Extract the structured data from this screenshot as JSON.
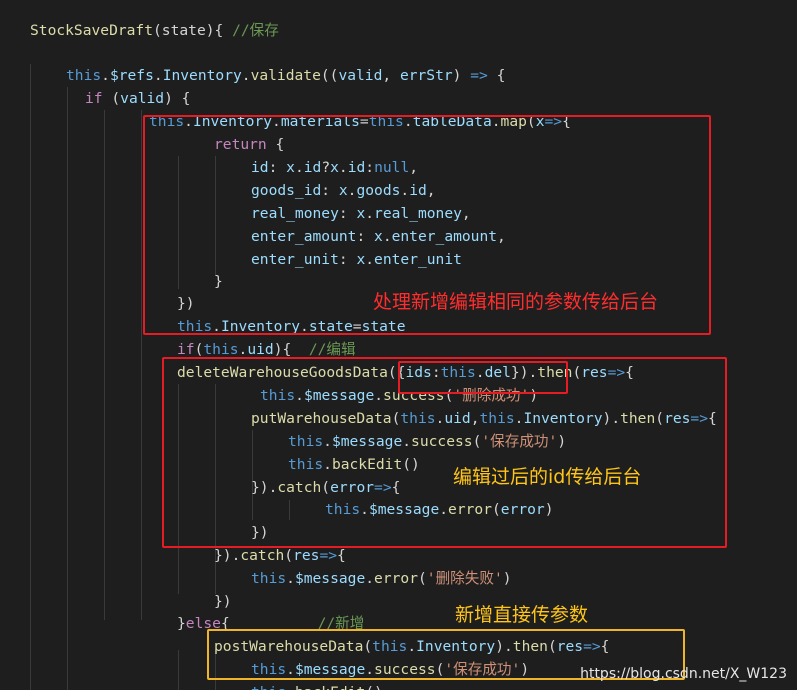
{
  "lines": [
    [
      [
        "tok-func",
        "StockSaveDraft"
      ],
      [
        "tok-plain",
        "(state){ "
      ],
      [
        "tok-cmt",
        "//保存"
      ]
    ],
    [],
    [
      [
        "tok-kw",
        "this"
      ],
      [
        "tok-plain",
        "."
      ],
      [
        "tok-prop",
        "$refs"
      ],
      [
        "tok-plain",
        "."
      ],
      [
        "tok-prop",
        "Inventory"
      ],
      [
        "tok-plain",
        "."
      ],
      [
        "tok-func",
        "validate"
      ],
      [
        "tok-plain",
        "(("
      ],
      [
        "tok-var",
        "valid"
      ],
      [
        "tok-plain",
        ", "
      ],
      [
        "tok-var",
        "errStr"
      ],
      [
        "tok-plain",
        ") "
      ],
      [
        "tok-arrow",
        "=>"
      ],
      [
        "tok-plain",
        " {"
      ]
    ],
    [
      [
        "tok-ctrl",
        "if"
      ],
      [
        "tok-plain",
        " ("
      ],
      [
        "tok-var",
        "valid"
      ],
      [
        "tok-plain",
        ") {"
      ]
    ],
    [
      [
        "tok-kw",
        "this"
      ],
      [
        "tok-plain",
        "."
      ],
      [
        "tok-prop",
        "Inventory"
      ],
      [
        "tok-plain",
        "."
      ],
      [
        "tok-prop",
        "materials"
      ],
      [
        "tok-plain",
        "="
      ],
      [
        "tok-kw",
        "this"
      ],
      [
        "tok-plain",
        "."
      ],
      [
        "tok-prop",
        "tableData"
      ],
      [
        "tok-plain",
        "."
      ],
      [
        "tok-func",
        "map"
      ],
      [
        "tok-plain",
        "("
      ],
      [
        "tok-var",
        "x"
      ],
      [
        "tok-arrow",
        "=>"
      ],
      [
        "tok-plain",
        "{"
      ]
    ],
    [
      [
        "tok-ctrl",
        "return"
      ],
      [
        "tok-plain",
        " {"
      ]
    ],
    [
      [
        "tok-prop",
        "id"
      ],
      [
        "tok-plain",
        ": "
      ],
      [
        "tok-var",
        "x"
      ],
      [
        "tok-plain",
        "."
      ],
      [
        "tok-prop",
        "id"
      ],
      [
        "tok-plain",
        "?"
      ],
      [
        "tok-var",
        "x"
      ],
      [
        "tok-plain",
        "."
      ],
      [
        "tok-prop",
        "id"
      ],
      [
        "tok-plain",
        ":"
      ],
      [
        "tok-kw",
        "null"
      ],
      [
        "tok-plain",
        ","
      ]
    ],
    [
      [
        "tok-prop",
        "goods_id"
      ],
      [
        "tok-plain",
        ": "
      ],
      [
        "tok-var",
        "x"
      ],
      [
        "tok-plain",
        "."
      ],
      [
        "tok-prop",
        "goods"
      ],
      [
        "tok-plain",
        "."
      ],
      [
        "tok-prop",
        "id"
      ],
      [
        "tok-plain",
        ","
      ]
    ],
    [
      [
        "tok-prop",
        "real_money"
      ],
      [
        "tok-plain",
        ": "
      ],
      [
        "tok-var",
        "x"
      ],
      [
        "tok-plain",
        "."
      ],
      [
        "tok-prop",
        "real_money"
      ],
      [
        "tok-plain",
        ","
      ]
    ],
    [
      [
        "tok-prop",
        "enter_amount"
      ],
      [
        "tok-plain",
        ": "
      ],
      [
        "tok-var",
        "x"
      ],
      [
        "tok-plain",
        "."
      ],
      [
        "tok-prop",
        "enter_amount"
      ],
      [
        "tok-plain",
        ","
      ]
    ],
    [
      [
        "tok-prop",
        "enter_unit"
      ],
      [
        "tok-plain",
        ": "
      ],
      [
        "tok-var",
        "x"
      ],
      [
        "tok-plain",
        "."
      ],
      [
        "tok-prop",
        "enter_unit"
      ]
    ],
    [
      [
        "tok-plain",
        "}"
      ]
    ],
    [
      [
        "tok-plain",
        "})"
      ]
    ],
    [
      [
        "tok-kw",
        "this"
      ],
      [
        "tok-plain",
        "."
      ],
      [
        "tok-prop",
        "Inventory"
      ],
      [
        "tok-plain",
        "."
      ],
      [
        "tok-prop",
        "state"
      ],
      [
        "tok-plain",
        "="
      ],
      [
        "tok-var",
        "state"
      ]
    ],
    [
      [
        "tok-ctrl",
        "if"
      ],
      [
        "tok-plain",
        "("
      ],
      [
        "tok-kw",
        "this"
      ],
      [
        "tok-plain",
        "."
      ],
      [
        "tok-prop",
        "uid"
      ],
      [
        "tok-plain",
        "){  "
      ],
      [
        "tok-cmt",
        "//编辑"
      ]
    ],
    [
      [
        "tok-func",
        "deleteWarehouseGoodsData"
      ],
      [
        "tok-plain",
        "({"
      ],
      [
        "tok-prop",
        "ids"
      ],
      [
        "tok-plain",
        ":"
      ],
      [
        "tok-kw",
        "this"
      ],
      [
        "tok-plain",
        "."
      ],
      [
        "tok-prop",
        "del"
      ],
      [
        "tok-plain",
        "})."
      ],
      [
        "tok-func",
        "then"
      ],
      [
        "tok-plain",
        "("
      ],
      [
        "tok-var",
        "res"
      ],
      [
        "tok-arrow",
        "=>"
      ],
      [
        "tok-plain",
        "{"
      ]
    ],
    [
      [
        "tok-kw",
        "this"
      ],
      [
        "tok-plain",
        "."
      ],
      [
        "tok-prop",
        "$message"
      ],
      [
        "tok-plain",
        "."
      ],
      [
        "tok-func",
        "success"
      ],
      [
        "tok-plain",
        "("
      ],
      [
        "tok-str",
        "'删除成功'"
      ],
      [
        "tok-plain",
        ")"
      ]
    ],
    [
      [
        "tok-func",
        "putWarehouseData"
      ],
      [
        "tok-plain",
        "("
      ],
      [
        "tok-kw",
        "this"
      ],
      [
        "tok-plain",
        "."
      ],
      [
        "tok-prop",
        "uid"
      ],
      [
        "tok-plain",
        ","
      ],
      [
        "tok-kw",
        "this"
      ],
      [
        "tok-plain",
        "."
      ],
      [
        "tok-prop",
        "Inventory"
      ],
      [
        "tok-plain",
        ")."
      ],
      [
        "tok-func",
        "then"
      ],
      [
        "tok-plain",
        "("
      ],
      [
        "tok-var",
        "res"
      ],
      [
        "tok-arrow",
        "=>"
      ],
      [
        "tok-plain",
        "{"
      ]
    ],
    [
      [
        "tok-kw",
        "this"
      ],
      [
        "tok-plain",
        "."
      ],
      [
        "tok-prop",
        "$message"
      ],
      [
        "tok-plain",
        "."
      ],
      [
        "tok-func",
        "success"
      ],
      [
        "tok-plain",
        "("
      ],
      [
        "tok-str",
        "'保存成功'"
      ],
      [
        "tok-plain",
        ")"
      ]
    ],
    [
      [
        "tok-kw",
        "this"
      ],
      [
        "tok-plain",
        "."
      ],
      [
        "tok-func",
        "backEdit"
      ],
      [
        "tok-plain",
        "()"
      ]
    ],
    [
      [
        "tok-plain",
        "})."
      ],
      [
        "tok-func",
        "catch"
      ],
      [
        "tok-plain",
        "("
      ],
      [
        "tok-var",
        "error"
      ],
      [
        "tok-arrow",
        "=>"
      ],
      [
        "tok-plain",
        "{"
      ]
    ],
    [
      [
        "tok-kw",
        "this"
      ],
      [
        "tok-plain",
        "."
      ],
      [
        "tok-prop",
        "$message"
      ],
      [
        "tok-plain",
        "."
      ],
      [
        "tok-func",
        "error"
      ],
      [
        "tok-plain",
        "("
      ],
      [
        "tok-var",
        "error"
      ],
      [
        "tok-plain",
        ")"
      ]
    ],
    [
      [
        "tok-plain",
        "})"
      ]
    ],
    [
      [
        "tok-plain",
        "})."
      ],
      [
        "tok-func",
        "catch"
      ],
      [
        "tok-plain",
        "("
      ],
      [
        "tok-var",
        "res"
      ],
      [
        "tok-arrow",
        "=>"
      ],
      [
        "tok-plain",
        "{"
      ]
    ],
    [
      [
        "tok-kw",
        "this"
      ],
      [
        "tok-plain",
        "."
      ],
      [
        "tok-prop",
        "$message"
      ],
      [
        "tok-plain",
        "."
      ],
      [
        "tok-func",
        "error"
      ],
      [
        "tok-plain",
        "("
      ],
      [
        "tok-str",
        "'删除失败'"
      ],
      [
        "tok-plain",
        ")"
      ]
    ],
    [
      [
        "tok-plain",
        "})"
      ]
    ],
    [
      [
        "tok-plain",
        "}"
      ],
      [
        "tok-ctrl",
        "else"
      ],
      [
        "tok-plain",
        "{          "
      ],
      [
        "tok-cmt",
        "//新增"
      ]
    ],
    [
      [
        "tok-func",
        "postWarehouseData"
      ],
      [
        "tok-plain",
        "("
      ],
      [
        "tok-kw",
        "this"
      ],
      [
        "tok-plain",
        "."
      ],
      [
        "tok-prop",
        "Inventory"
      ],
      [
        "tok-plain",
        ")."
      ],
      [
        "tok-func",
        "then"
      ],
      [
        "tok-plain",
        "("
      ],
      [
        "tok-var",
        "res"
      ],
      [
        "tok-arrow",
        "=>"
      ],
      [
        "tok-plain",
        "{"
      ]
    ],
    [
      [
        "tok-kw",
        "this"
      ],
      [
        "tok-plain",
        "."
      ],
      [
        "tok-prop",
        "$message"
      ],
      [
        "tok-plain",
        "."
      ],
      [
        "tok-func",
        "success"
      ],
      [
        "tok-plain",
        "("
      ],
      [
        "tok-str",
        "'保存成功'"
      ],
      [
        "tok-plain",
        ")"
      ]
    ],
    [
      [
        "tok-kw",
        "this"
      ],
      [
        "tok-plain",
        "."
      ],
      [
        "tok-func",
        "backEdit"
      ],
      [
        "tok-plain",
        "()"
      ]
    ]
  ],
  "annotations": {
    "map_note": "处理新增编辑相同的参数传给后台",
    "edit_note": "编辑过后的id传给后台",
    "add_note": "新增直接传参数"
  },
  "watermark": "https://blog.csdn.net/X_W123",
  "colors": {
    "background": "#1e1e1e",
    "keyword": "#569cd6",
    "function": "#dcdcaa",
    "property": "#9cdcfe",
    "string": "#ce9178",
    "comment": "#6a9955",
    "control": "#c586c0",
    "box_red": "#e51c23",
    "box_yellow": "#f0b429"
  }
}
